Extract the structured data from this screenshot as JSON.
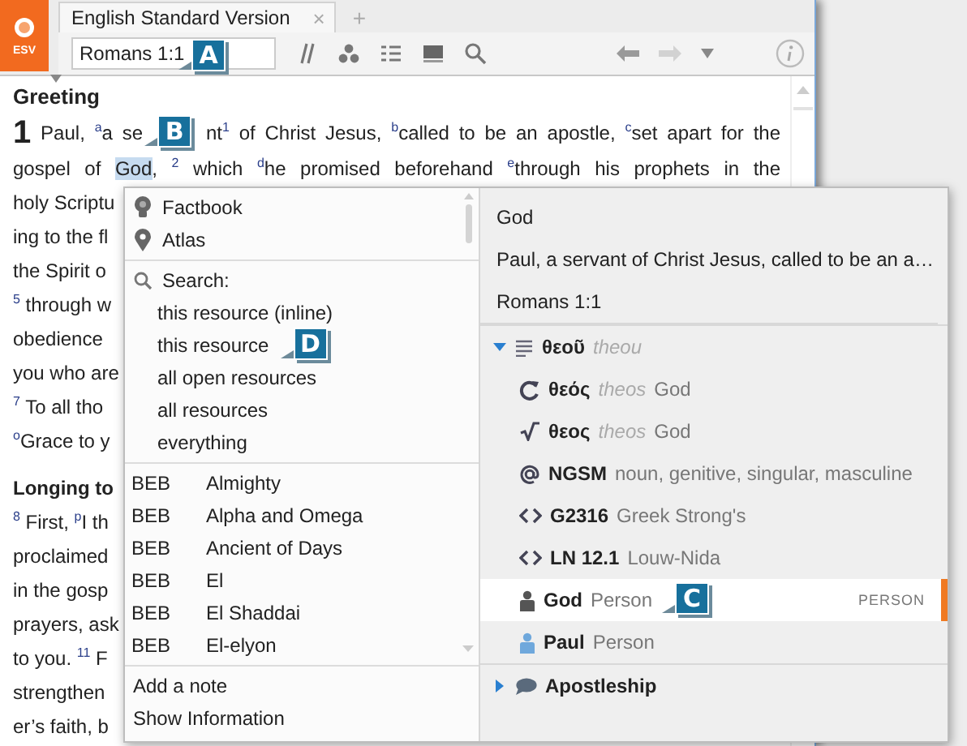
{
  "logo": {
    "label": "ESV"
  },
  "resource_tabs": [
    {
      "label": "English Standard Version",
      "close": "×",
      "selected": true
    }
  ],
  "new_tab": "+",
  "toolbar": {
    "reference": "Romans 1:1",
    "callout": "A"
  },
  "document": {
    "heading": "Greeting",
    "lines": [
      {
        "kind": "verse",
        "verse": "1",
        "text": "Paul, $^{a}$a se",
        "callout": "B",
        "rest": "nt$^{1}$ of Christ Jesus, $^{b}$called to be an apostle, $^{c}$set apart for the"
      },
      {
        "kind": "selection",
        "text": "gospel of",
        "selected_word": "God",
        "rest": ", $^{2}$ which $^{d}$he promised beforehand $^{e}$through his prophets in the"
      },
      {
        "kind": "text",
        "text": "holy Scriptu"
      },
      {
        "kind": "text",
        "text": "ing to the fl"
      },
      {
        "kind": "text",
        "text": "the Spirit o"
      },
      {
        "kind": "text",
        "text": "$^{5}$ through w"
      },
      {
        "kind": "text",
        "text": "obedience"
      },
      {
        "kind": "text",
        "text": "you who are"
      },
      {
        "kind": "text",
        "text": "$^{7}$ To all tho"
      },
      {
        "kind": "text",
        "text": "$^{o}$Grace to y"
      },
      {
        "kind": "heading",
        "text": "Longing to"
      },
      {
        "kind": "text",
        "text": "$^{8}$ First, $^{p}$I th"
      },
      {
        "kind": "text",
        "text": "proclaimed"
      },
      {
        "kind": "text",
        "text": "in the gosp"
      },
      {
        "kind": "text",
        "text": "prayers, ask"
      },
      {
        "kind": "text",
        "text": "to you. $^{11}$ F"
      },
      {
        "kind": "text",
        "text": "strengthen"
      },
      {
        "kind": "text",
        "text": "er’s faith, b"
      }
    ]
  },
  "lookup_menu": {
    "references": [
      {
        "kind": "factbook",
        "label": "Factbook"
      },
      {
        "kind": "atlas",
        "label": "Atlas"
      }
    ],
    "search": {
      "label": "Search:",
      "options": [
        {
          "label": "this resource (inline)"
        },
        {
          "label": "this resource",
          "callout": "D"
        },
        {
          "label": "all open resources"
        },
        {
          "label": "all resources"
        },
        {
          "label": "everything"
        }
      ]
    },
    "topics": [
      {
        "source": "BEB",
        "term": "Almighty"
      },
      {
        "source": "BEB",
        "term": "Alpha and Omega"
      },
      {
        "source": "BEB",
        "term": "Ancient of Days"
      },
      {
        "source": "BEB",
        "term": "El"
      },
      {
        "source": "BEB",
        "term": "El Shaddai"
      },
      {
        "source": "BEB",
        "term": "El-elyon"
      }
    ],
    "actions": [
      {
        "label": "Add a note"
      },
      {
        "label": "Show Information"
      }
    ]
  },
  "selection_info": {
    "items": [
      {
        "label": "God"
      },
      {
        "label": "Paul, a servant of Christ Jesus, called to be an a…"
      },
      {
        "label": "Romans 1:1"
      }
    ],
    "tree": [
      {
        "kind": "word",
        "term": "θεοῦ",
        "transliteration": "theou",
        "expanded": true,
        "children": [
          {
            "kind": "lemma",
            "term": "θεός",
            "transliteration": "theos",
            "gloss": "God",
            "selected": false
          },
          {
            "kind": "root",
            "term": "θεος",
            "transliteration": "theos",
            "gloss": "God",
            "selected": false
          },
          {
            "kind": "morphology",
            "term": "NGSM",
            "gloss": "noun, genitive, singular, masculine",
            "selected": false
          },
          {
            "kind": "strongs",
            "term": "G2316",
            "gloss": "Greek Strong's",
            "selected": false
          },
          {
            "kind": "louw_nida",
            "term": "LN 12.1",
            "gloss": "Louw-Nida",
            "selected": false
          },
          {
            "kind": "person",
            "term": "God",
            "gloss": "Person",
            "color": "#555555",
            "tag": "PERSON",
            "callout": "C",
            "selected": true
          },
          {
            "kind": "person",
            "term": "Paul",
            "gloss": "Person",
            "color": "#6fa8dc",
            "selected": false
          }
        ]
      },
      {
        "kind": "topic",
        "term": "Apostleship",
        "expanded": false
      }
    ]
  }
}
